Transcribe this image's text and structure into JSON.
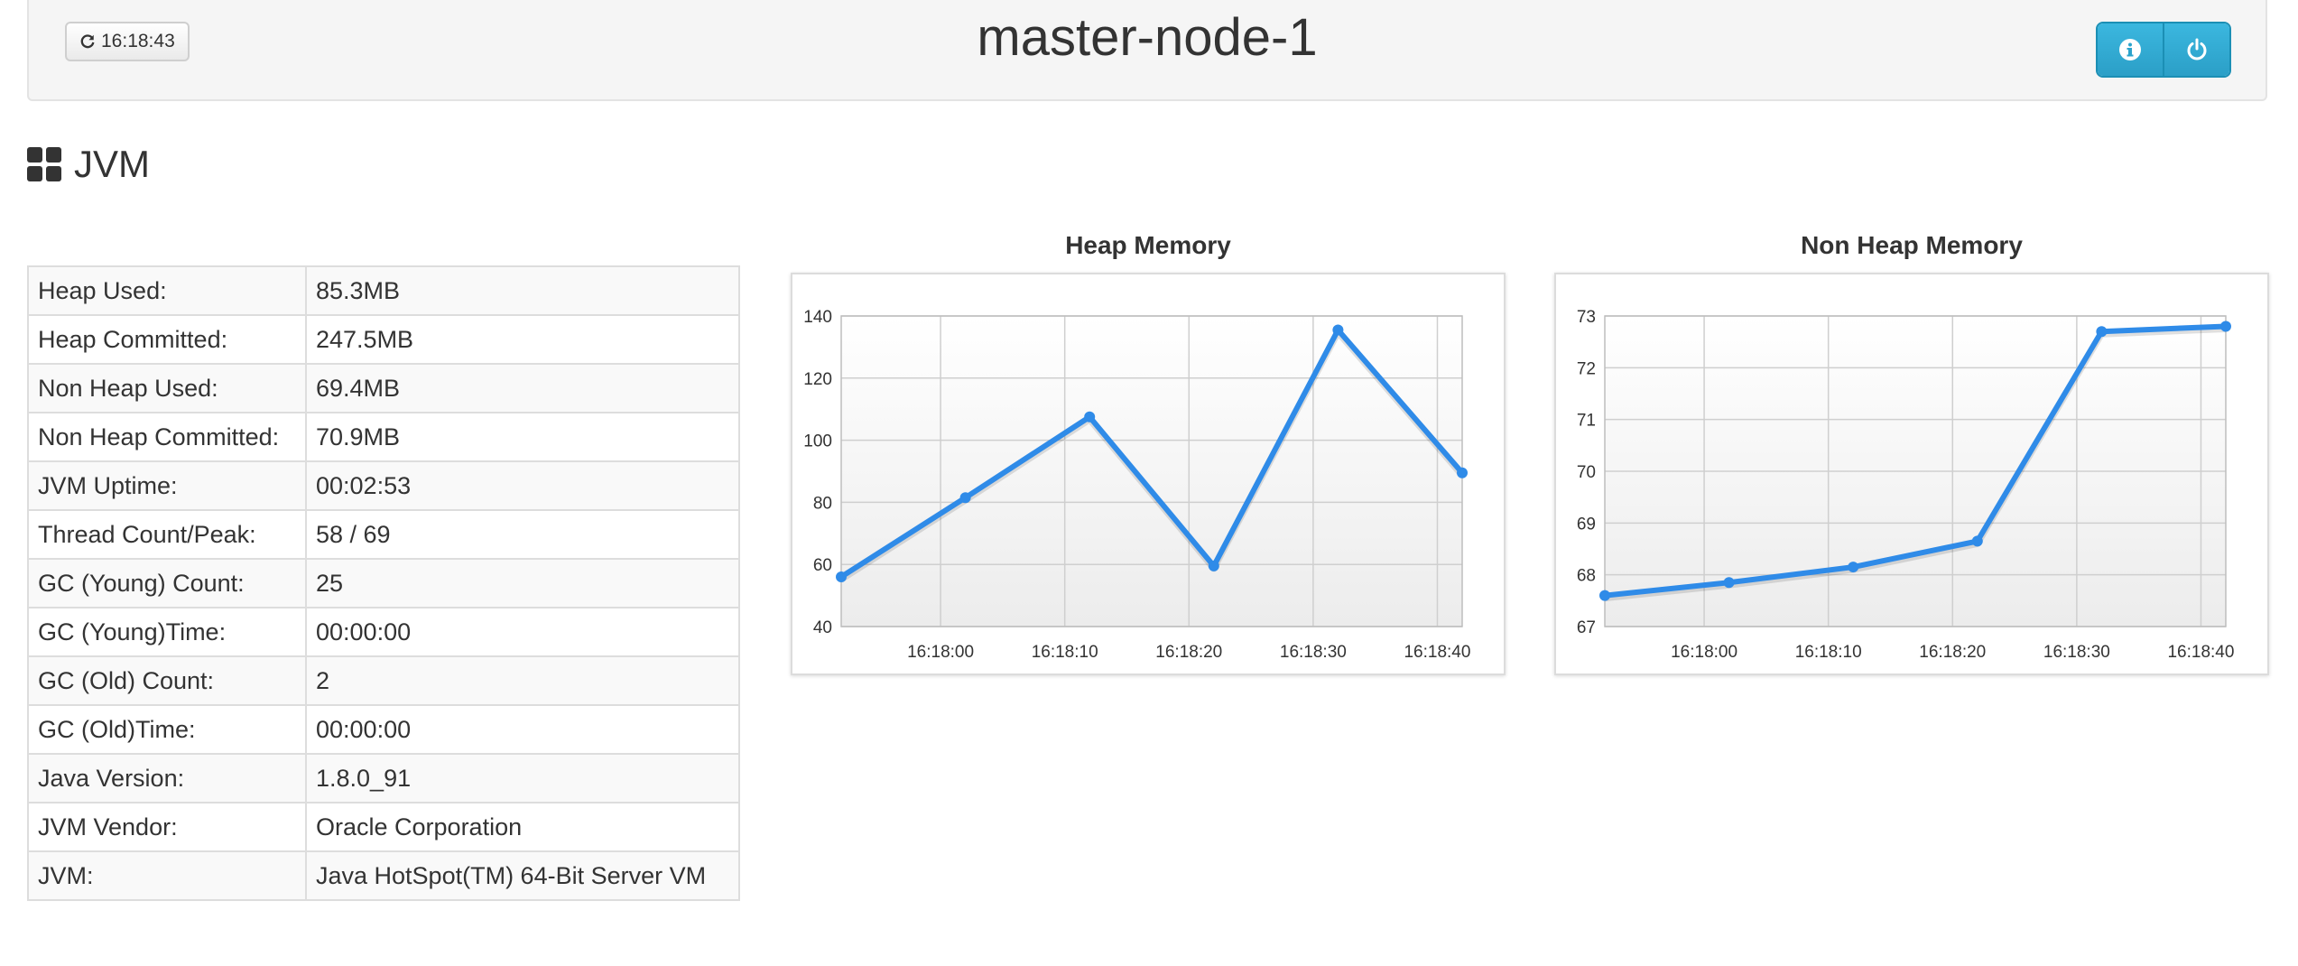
{
  "header": {
    "refresh_label": "16:18:43",
    "node_name": "master-node-1",
    "accent": "#2fa8d5"
  },
  "section": {
    "title": "JVM"
  },
  "stats": [
    {
      "label": "Heap Used:",
      "value": "85.3MB"
    },
    {
      "label": "Heap Committed:",
      "value": "247.5MB"
    },
    {
      "label": "Non Heap Used:",
      "value": "69.4MB"
    },
    {
      "label": "Non Heap Committed:",
      "value": "70.9MB"
    },
    {
      "label": "JVM Uptime:",
      "value": "00:02:53"
    },
    {
      "label": "Thread Count/Peak:",
      "value": "58 / 69"
    },
    {
      "label": "GC (Young) Count:",
      "value": "25"
    },
    {
      "label": "GC (Young)Time:",
      "value": "00:00:00"
    },
    {
      "label": "GC (Old) Count:",
      "value": "2"
    },
    {
      "label": "GC (Old)Time:",
      "value": "00:00:00"
    },
    {
      "label": "Java Version:",
      "value": "1.8.0_91"
    },
    {
      "label": "JVM Vendor:",
      "value": "Oracle Corporation"
    },
    {
      "label": "JVM:",
      "value": "Java HotSpot(TM) 64-Bit Server VM"
    }
  ],
  "chart_data": [
    {
      "type": "line",
      "title": "Heap Memory",
      "x": [
        "16:17:52",
        "16:18:02",
        "16:18:12",
        "16:18:22",
        "16:18:32",
        "16:18:42"
      ],
      "xticks": [
        "16:18:00",
        "16:18:10",
        "16:18:20",
        "16:18:30",
        "16:18:40"
      ],
      "xrange": [
        "16:17:52",
        "16:18:42"
      ],
      "values": [
        56,
        81.5,
        107.5,
        59.5,
        135.5,
        89.5
      ],
      "yticks": [
        40,
        60,
        80,
        100,
        120,
        140
      ],
      "ylim": [
        40,
        140
      ],
      "grid": true,
      "color": "#2f8be8"
    },
    {
      "type": "line",
      "title": "Non Heap Memory",
      "x": [
        "16:17:52",
        "16:18:02",
        "16:18:12",
        "16:18:22",
        "16:18:32",
        "16:18:42"
      ],
      "xticks": [
        "16:18:00",
        "16:18:10",
        "16:18:20",
        "16:18:30",
        "16:18:40"
      ],
      "xrange": [
        "16:17:52",
        "16:18:42"
      ],
      "values": [
        67.6,
        67.85,
        68.15,
        68.65,
        72.7,
        72.8
      ],
      "yticks": [
        67,
        68,
        69,
        70,
        71,
        72,
        73
      ],
      "ylim": [
        67,
        73
      ],
      "grid": true,
      "color": "#2f8be8"
    }
  ]
}
